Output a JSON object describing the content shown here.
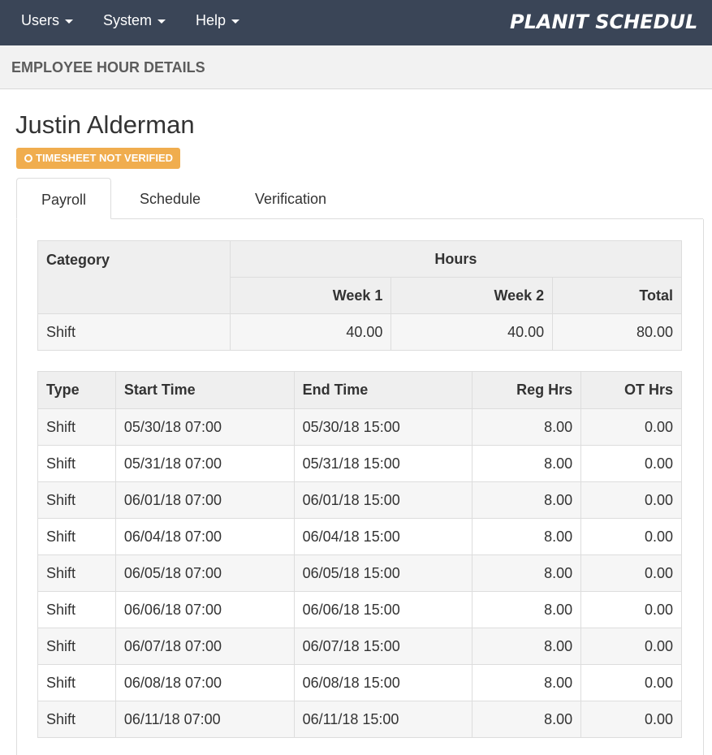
{
  "nav": {
    "items": [
      {
        "label": "Users"
      },
      {
        "label": "System"
      },
      {
        "label": "Help"
      }
    ],
    "logo_text": "PLANIT SCHEDUL"
  },
  "subheader": {
    "title": "EMPLOYEE HOUR DETAILS"
  },
  "employee": {
    "name": "Justin Alderman",
    "status_badge": "TIMESHEET NOT VERIFIED"
  },
  "tabs": [
    {
      "label": "Payroll",
      "active": true
    },
    {
      "label": "Schedule",
      "active": false
    },
    {
      "label": "Verification",
      "active": false
    }
  ],
  "summary": {
    "headers": {
      "category": "Category",
      "hours": "Hours",
      "week1": "Week 1",
      "week2": "Week 2",
      "total": "Total"
    },
    "rows": [
      {
        "category": "Shift",
        "week1": "40.00",
        "week2": "40.00",
        "total": "80.00"
      }
    ]
  },
  "details": {
    "headers": {
      "type": "Type",
      "start": "Start Time",
      "end": "End Time",
      "reg": "Reg Hrs",
      "ot": "OT Hrs"
    },
    "rows": [
      {
        "type": "Shift",
        "start": "05/30/18 07:00",
        "end": "05/30/18 15:00",
        "reg": "8.00",
        "ot": "0.00"
      },
      {
        "type": "Shift",
        "start": "05/31/18 07:00",
        "end": "05/31/18 15:00",
        "reg": "8.00",
        "ot": "0.00"
      },
      {
        "type": "Shift",
        "start": "06/01/18 07:00",
        "end": "06/01/18 15:00",
        "reg": "8.00",
        "ot": "0.00"
      },
      {
        "type": "Shift",
        "start": "06/04/18 07:00",
        "end": "06/04/18 15:00",
        "reg": "8.00",
        "ot": "0.00"
      },
      {
        "type": "Shift",
        "start": "06/05/18 07:00",
        "end": "06/05/18 15:00",
        "reg": "8.00",
        "ot": "0.00"
      },
      {
        "type": "Shift",
        "start": "06/06/18 07:00",
        "end": "06/06/18 15:00",
        "reg": "8.00",
        "ot": "0.00"
      },
      {
        "type": "Shift",
        "start": "06/07/18 07:00",
        "end": "06/07/18 15:00",
        "reg": "8.00",
        "ot": "0.00"
      },
      {
        "type": "Shift",
        "start": "06/08/18 07:00",
        "end": "06/08/18 15:00",
        "reg": "8.00",
        "ot": "0.00"
      },
      {
        "type": "Shift",
        "start": "06/11/18 07:00",
        "end": "06/11/18 15:00",
        "reg": "8.00",
        "ot": "0.00"
      }
    ]
  },
  "colors": {
    "navbar": "#3a4557",
    "badge": "#f0ad4e",
    "header_bg": "#efefef"
  }
}
